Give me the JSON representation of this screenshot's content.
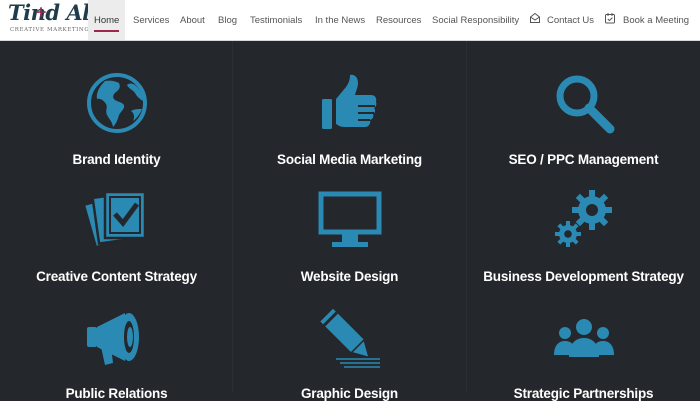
{
  "brand": {
    "logo_text": "Tind All",
    "tagline": "CREATIVE MARKETING",
    "accent_color": "#9d2653",
    "icon_color": "#2a8ab4",
    "bg_color": "#24272b"
  },
  "nav": {
    "home": "Home",
    "services": "Services",
    "about": "About",
    "blog": "Blog",
    "testimonials": "Testimonials",
    "news": "In the News",
    "resources": "Resources",
    "social": "Social Responsibility",
    "contact": "Contact Us",
    "meeting": "Book a Meeting",
    "active": "Home"
  },
  "services": [
    {
      "label": "Brand Identity",
      "icon": "globe-icon"
    },
    {
      "label": "Social Media Marketing",
      "icon": "thumbs-up-icon"
    },
    {
      "label": "SEO / PPC Management",
      "icon": "magnifier-icon"
    },
    {
      "label": "Creative Content Strategy",
      "icon": "checked-documents-icon"
    },
    {
      "label": "Website Design",
      "icon": "monitor-icon"
    },
    {
      "label": "Business Development Strategy",
      "icon": "gears-icon"
    },
    {
      "label": "Public Relations",
      "icon": "megaphone-icon"
    },
    {
      "label": "Graphic Design",
      "icon": "pencil-icon"
    },
    {
      "label": "Strategic Partnerships",
      "icon": "people-group-icon"
    }
  ]
}
